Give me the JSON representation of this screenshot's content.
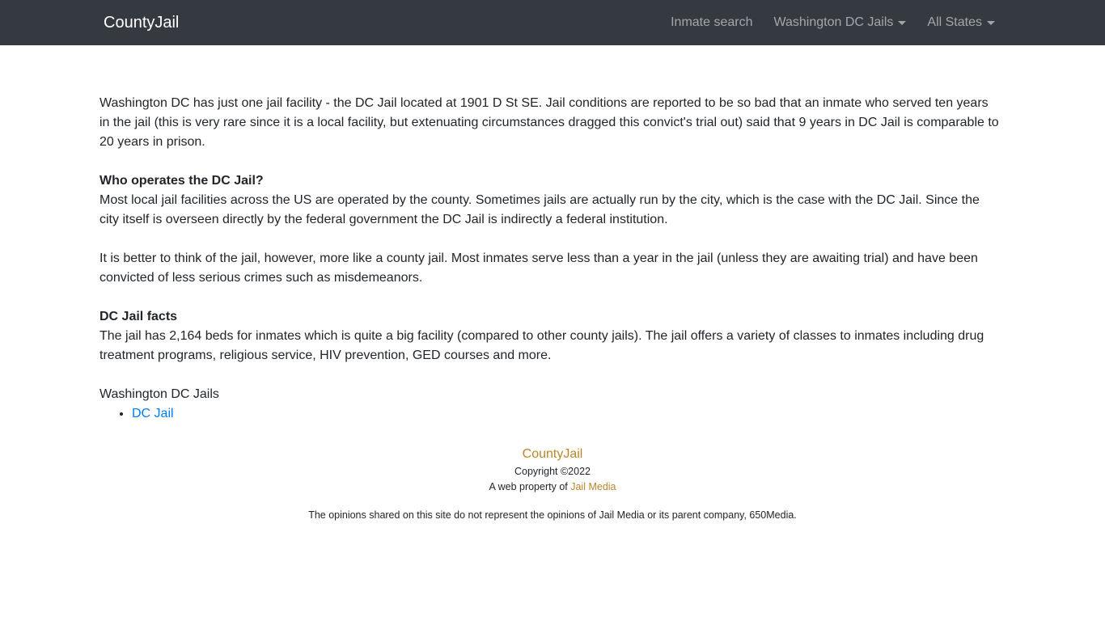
{
  "navbar": {
    "brand": "CountyJail",
    "links": [
      {
        "label": "Inmate search",
        "dropdown": false
      },
      {
        "label": "Washington DC Jails",
        "dropdown": true
      },
      {
        "label": "All States",
        "dropdown": true
      }
    ]
  },
  "main": {
    "intro": "Washington DC has just one jail facility - the DC Jail located at 1901 D St SE. Jail conditions are reported to be so bad that an inmate who served ten years in the jail (this is very rare since it is a local facility, but extenuating circumstances dragged this convict's trial out) said that 9 years in DC Jail is comparable to 20 years in prison.",
    "section1": {
      "heading": "Who operates the DC Jail?",
      "body": "Most local jail facilities across the US are operated by the county. Sometimes jails are actually run by the city, which is the case with the DC Jail. Since the city itself is overseen directly by the federal government the DC Jail is indirectly a federal institution."
    },
    "paragraph2": "It is better to think of the jail, however, more like a county jail. Most inmates serve less than a year in the jail (unless they are awaiting trial) and have been convicted of less serious crimes such as misdemeanors.",
    "section2": {
      "heading": "DC Jail facts",
      "body": "The jail has 2,164 beds for inmates which is quite a big facility (compared to other county jails). The jail offers a variety of classes to inmates including drug treatment programs, religious service, HIV prevention, GED courses and more."
    },
    "jails_title": "Washington DC Jails",
    "jails": [
      "DC Jail"
    ]
  },
  "footer": {
    "brand": "CountyJail",
    "copyright": "Copyright ©2022",
    "property_prefix": "A web property of",
    "property_link": "Jail Media",
    "disclaimer": "The opinions shared on this site do not represent the opinions of Jail Media or its parent company, 650Media."
  },
  "colors": {
    "navbar_bg": "#343a40",
    "link_blue": "#007bff",
    "footer_gold": "#b8862b"
  }
}
